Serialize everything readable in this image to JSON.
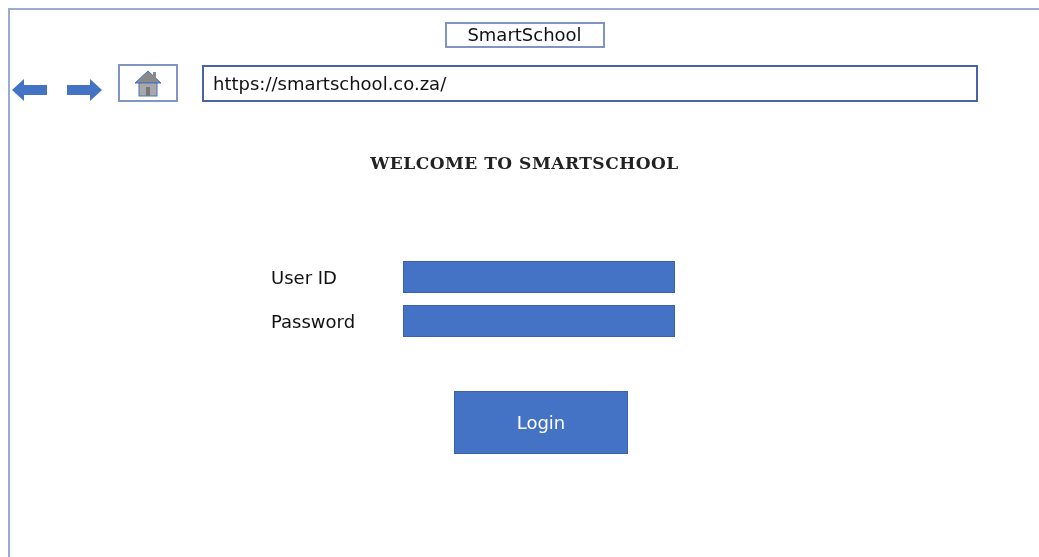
{
  "window": {
    "title": "SmartSchool"
  },
  "address_bar": {
    "url": "https://smartschool.co.za/"
  },
  "heading": "WELCOME TO SMARTSCHOOL",
  "form": {
    "fields": [
      {
        "label": "User ID"
      },
      {
        "label": "Password"
      }
    ],
    "button": "Login"
  }
}
